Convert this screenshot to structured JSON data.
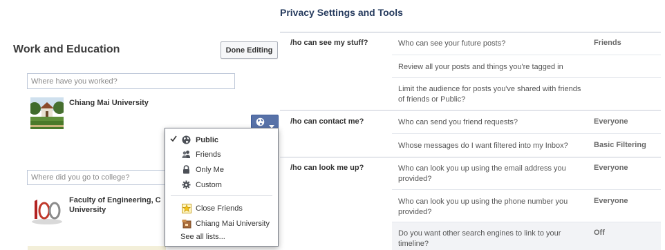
{
  "work_education": {
    "title": "Work and Education",
    "done_button": "Done Editing",
    "work_placeholder": "Where have you worked?",
    "employer": "Chiang Mai University",
    "college_placeholder": "Where did you go to college?",
    "school_line1": "Faculty of Engineering, C",
    "school_line2": "University"
  },
  "audience_menu": {
    "items": [
      {
        "label": "Public",
        "icon": "globe-icon",
        "selected": true
      },
      {
        "label": "Friends",
        "icon": "friends-icon",
        "selected": false
      },
      {
        "label": "Only Me",
        "icon": "lock-icon",
        "selected": false
      },
      {
        "label": "Custom",
        "icon": "gear-icon",
        "selected": false
      },
      {
        "label": "Close Friends",
        "icon": "star-list-icon",
        "selected": false
      },
      {
        "label": "Chiang Mai University",
        "icon": "school-list-icon",
        "selected": false
      }
    ],
    "see_all": "See all lists..."
  },
  "privacy": {
    "title": "Privacy Settings and Tools",
    "sections": [
      {
        "category": "/ho can see my stuff?",
        "rows": [
          {
            "question": "Who can see your future posts?",
            "value": "Friends"
          },
          {
            "question": "Review all your posts and things you're tagged in",
            "value": ""
          },
          {
            "question": "Limit the audience for posts you've shared with friends of friends or Public?",
            "value": ""
          }
        ]
      },
      {
        "category": "/ho can contact me?",
        "rows": [
          {
            "question": "Who can send you friend requests?",
            "value": "Everyone"
          },
          {
            "question": "Whose messages do I want filtered into my Inbox?",
            "value": "Basic Filtering"
          }
        ]
      },
      {
        "category": "/ho can look me up?",
        "rows": [
          {
            "question": "Who can look you up using the email address you provided?",
            "value": "Everyone"
          },
          {
            "question": "Who can look you up using the phone number you provided?",
            "value": "Everyone"
          },
          {
            "question": "Do you want other search engines to link to your timeline?",
            "value": "Off"
          }
        ]
      }
    ]
  },
  "colors": {
    "accent": "#3b5998",
    "title_navy": "#263b5e",
    "highlight_row": "#f2f3f6"
  }
}
